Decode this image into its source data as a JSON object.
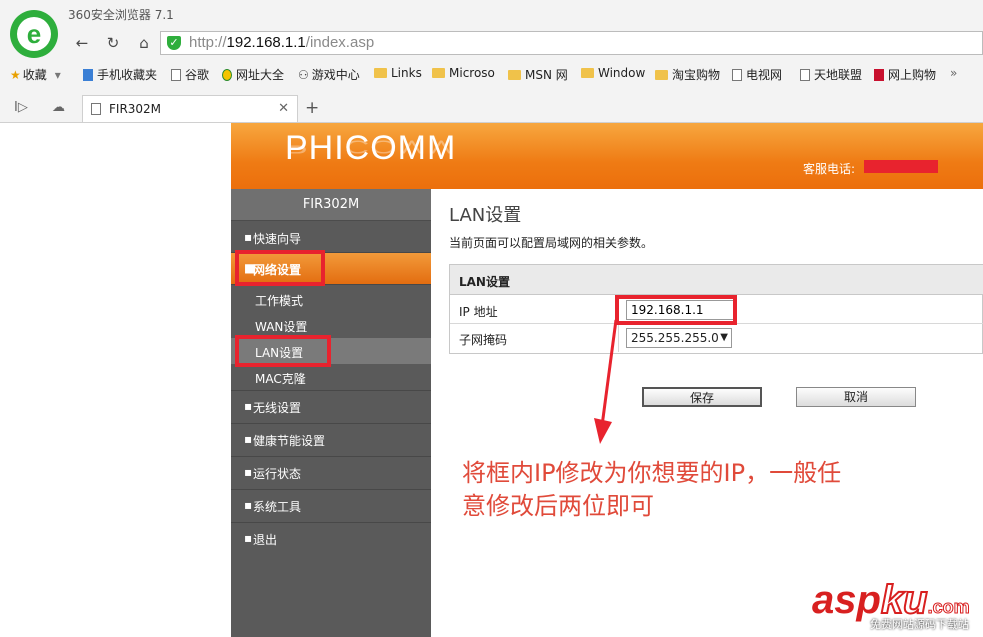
{
  "browser": {
    "app_title": "360安全浏览器 7.1",
    "url_scheme": "http://",
    "url_host": "192.168.1.1",
    "url_path": "/index.asp",
    "bookmarks": [
      "收藏",
      "手机收藏夹",
      "谷歌",
      "网址大全",
      "游戏中心",
      "Links",
      "Microso",
      "MSN 网",
      "Window",
      "淘宝购物",
      "电视网",
      "天地联盟",
      "网上购物"
    ],
    "tab_title": "FIR302M"
  },
  "router": {
    "brand": "PHICOMM",
    "hotline_label": "客服电话:",
    "model": "FIR302M",
    "sidebar": {
      "quick_setup": "快速向导",
      "network": "网络设置",
      "work_mode": "工作模式",
      "wan": "WAN设置",
      "lan": "LAN设置",
      "mac_clone": "MAC克隆",
      "wireless": "无线设置",
      "health": "健康节能设置",
      "status": "运行状态",
      "tools": "系统工具",
      "logout": "退出"
    },
    "page_title": "LAN设置",
    "page_desc": "当前页面可以配置局域网的相关参数。",
    "table_title": "LAN设置",
    "ip_label": "IP 地址",
    "ip_value": "192.168.1.1",
    "mask_label": "子网掩码",
    "mask_value": "255.255.255.0",
    "save": "保存",
    "cancel": "取消"
  },
  "annotation": {
    "line1": "将框内IP修改为你想要的IP，一般任",
    "line2": "意修改后两位即可",
    "color": "#e04a3a"
  },
  "watermark": {
    "asp": "asp",
    "ku": "ku",
    "com": ".com",
    "sub": "免费网站源码下载站"
  }
}
